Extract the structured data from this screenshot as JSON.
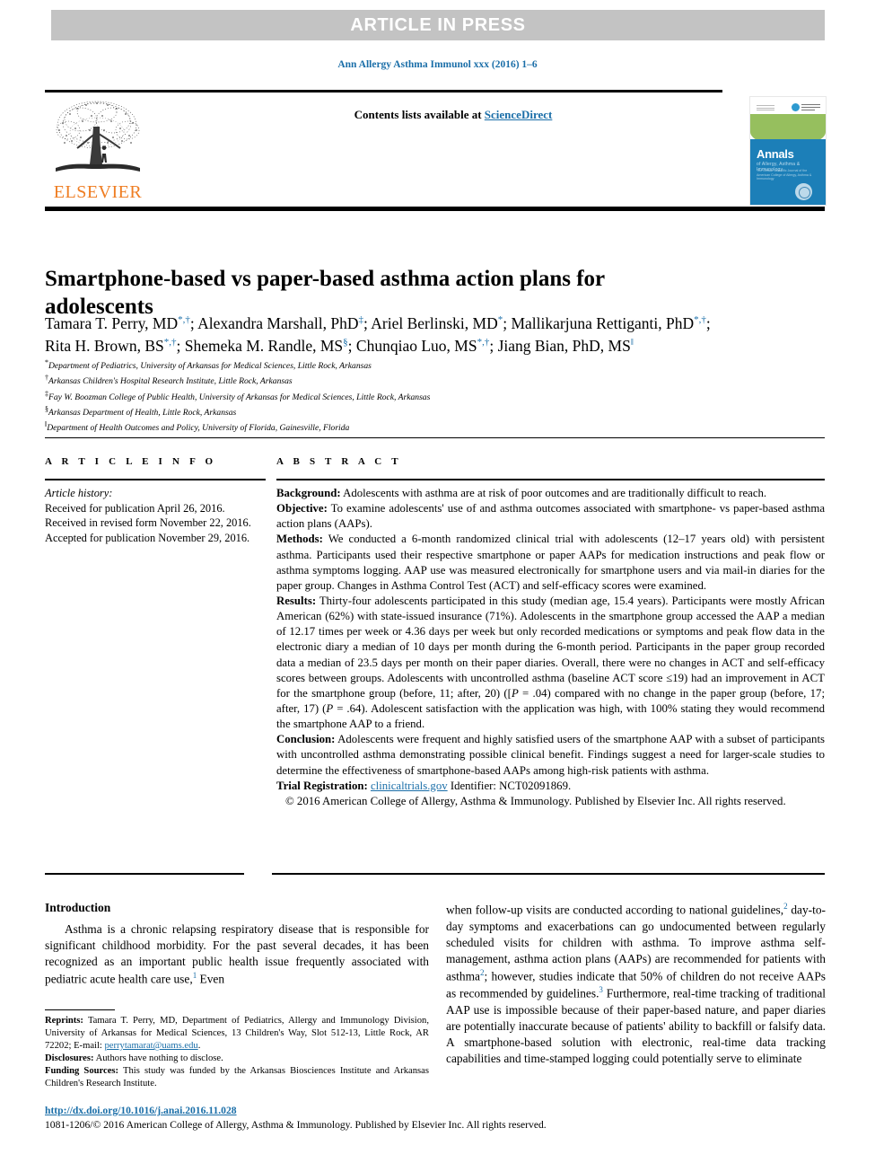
{
  "banner": {
    "text": "ARTICLE IN PRESS",
    "bg_color": "#c3c3c3",
    "text_color": "#ffffff"
  },
  "journal_citation": "Ann Allergy Asthma Immunol xxx (2016) 1–6",
  "masthead": {
    "contents_prefix": "Contents lists available at ",
    "sciencedirect": "ScienceDirect",
    "publisher_name": "ELSEVIER",
    "publisher_color": "#ef7d22",
    "cover": {
      "title": "Annals",
      "subtitle": "of Allergy, Asthma & Immunology",
      "tagline": "The Official Scientific Journal of the American College of Allergy, Asthma & Immunology",
      "green_color": "#96bf5e",
      "blue_color": "#1c7fb8"
    }
  },
  "article": {
    "title": "Smartphone-based vs paper-based asthma action plans for adolescents",
    "authors_line1": "Tamara T. Perry, MD",
    "authors_html_line1": "Tamara T. Perry, MD<sup>*,†</sup>; Alexandra Marshall, PhD<sup>‡</sup>; Ariel Berlinski, MD<sup>*</sup>; Mallikarjuna Rettiganti, PhD<sup>*,†</sup>;",
    "authors_html_line2": "Rita H. Brown, BS<sup>*,†</sup>; Shemeka M. Randle, MS<sup>§</sup>; Chunqiao Luo, MS<sup>*,†</sup>; Jiang Bian, PhD, MS<sup>‖</sup>",
    "affiliations": [
      {
        "marker": "*",
        "text": "Department of Pediatrics, University of Arkansas for Medical Sciences, Little Rock, Arkansas"
      },
      {
        "marker": "†",
        "text": "Arkansas Children's Hospital Research Institute, Little Rock, Arkansas"
      },
      {
        "marker": "‡",
        "text": "Fay W. Boozman College of Public Health, University of Arkansas for Medical Sciences, Little Rock, Arkansas"
      },
      {
        "marker": "§",
        "text": "Arkansas Department of Health, Little Rock, Arkansas"
      },
      {
        "marker": "‖",
        "text": "Department of Health Outcomes and Policy, University of Florida, Gainesville, Florida"
      }
    ]
  },
  "article_info": {
    "heading": "A R T I C L E   I N F O",
    "history_label": "Article history:",
    "received": "Received for publication April 26, 2016.",
    "revised": "Received in revised form November 22, 2016.",
    "accepted": "Accepted for publication November 29, 2016."
  },
  "abstract": {
    "heading": "A B S T R A C T",
    "background_label": "Background:",
    "background_text": " Adolescents with asthma are at risk of poor outcomes and are traditionally difficult to reach.",
    "objective_label": "Objective:",
    "objective_text": " To examine adolescents' use of and asthma outcomes associated with smartphone- vs paper-based asthma action plans (AAPs).",
    "methods_label": "Methods:",
    "methods_text": " We conducted a 6-month randomized clinical trial with adolescents (12–17 years old) with persistent asthma. Participants used their respective smartphone or paper AAPs for medication instructions and peak flow or asthma symptoms logging. AAP use was measured electronically for smartphone users and via mail-in diaries for the paper group. Changes in Asthma Control Test (ACT) and self-efficacy scores were examined.",
    "results_label": "Results:",
    "results_text_a": " Thirty-four adolescents participated in this study (median age, 15.4 years). Participants were mostly African American (62%) with state-issued insurance (71%). Adolescents in the smartphone group accessed the AAP a median of 12.17 times per week or 4.36 days per week but only recorded medications or symptoms and peak flow data in the electronic diary a median of 10 days per month during the 6-month period. Participants in the paper group recorded data a median of 23.5 days per month on their paper diaries. Overall, there were no changes in ACT and self-efficacy scores between groups. Adolescents with uncontrolled asthma (baseline ACT score ≤19) had an improvement in ACT for the smartphone group (before, 11; after, 20) ([",
    "results_p1": "P",
    "results_text_b": " = .04) compared with no change in the paper group (before, 17; after, 17) (",
    "results_p2": "P",
    "results_text_c": " = .64). Adolescent satisfaction with the application was high, with 100% stating they would recommend the smartphone AAP to a friend.",
    "conclusion_label": "Conclusion:",
    "conclusion_text": " Adolescents were frequent and highly satisfied users of the smartphone AAP with a subset of participants with uncontrolled asthma demonstrating possible clinical benefit. Findings suggest a need for larger-scale studies to determine the effectiveness of smartphone-based AAPs among high-risk patients with asthma.",
    "trial_label": "Trial Registration:",
    "trial_link": "clinicaltrials.gov",
    "trial_text": " Identifier: NCT02091869.",
    "copyright": "© 2016 American College of Allergy, Asthma & Immunology. Published by Elsevier Inc. All rights reserved."
  },
  "introduction": {
    "heading": "Introduction",
    "left_text_a": "Asthma is a chronic relapsing respiratory disease that is responsible for significant childhood morbidity. For the past several decades, it has been recognized as an important public health issue frequently associated with pediatric acute health care use,",
    "left_ref1": "1",
    "left_text_b": " Even",
    "right_text_a": "when follow-up visits are conducted according to national guidelines,",
    "right_ref1": "2",
    "right_text_b": " day-to-day symptoms and exacerbations can go undocumented between regularly scheduled visits for children with asthma. To improve asthma self-management, asthma action plans (AAPs) are recommended for patients with asthma",
    "right_ref2": "2",
    "right_text_c": "; however, studies indicate that 50% of children do not receive AAPs as recommended by guidelines.",
    "right_ref3": "3",
    "right_text_d": " Furthermore, real-time tracking of traditional AAP use is impossible because of their paper-based nature, and paper diaries are potentially inaccurate because of patients' ability to backfill or falsify data. A smartphone-based solution with electronic, real-time data tracking capabilities and time-stamped logging could potentially serve to eliminate"
  },
  "footnotes": {
    "reprints_label": "Reprints:",
    "reprints_text_a": " Tamara T. Perry, MD, Department of Pediatrics, Allergy and Immunology Division, University of Arkansas for Medical Sciences, 13 Children's Way, Slot 512-13, Little Rock, AR 72202; E-mail: ",
    "reprints_email": "perrytamarat@uams.edu",
    "reprints_text_b": ".",
    "disclosures_label": "Disclosures:",
    "disclosures_text": " Authors have nothing to disclose.",
    "funding_label": "Funding Sources:",
    "funding_text": " This study was funded by the Arkansas Biosciences Institute and Arkansas Children's Research Institute."
  },
  "footer": {
    "doi": "http://dx.doi.org/10.1016/j.anai.2016.11.028",
    "copyright": "1081-1206/© 2016 American College of Allergy, Asthma & Immunology. Published by Elsevier Inc. All rights reserved."
  },
  "colors": {
    "link": "#1a6ea8",
    "elsevier_orange": "#ef7d22",
    "banner_gray": "#c3c3c3"
  }
}
